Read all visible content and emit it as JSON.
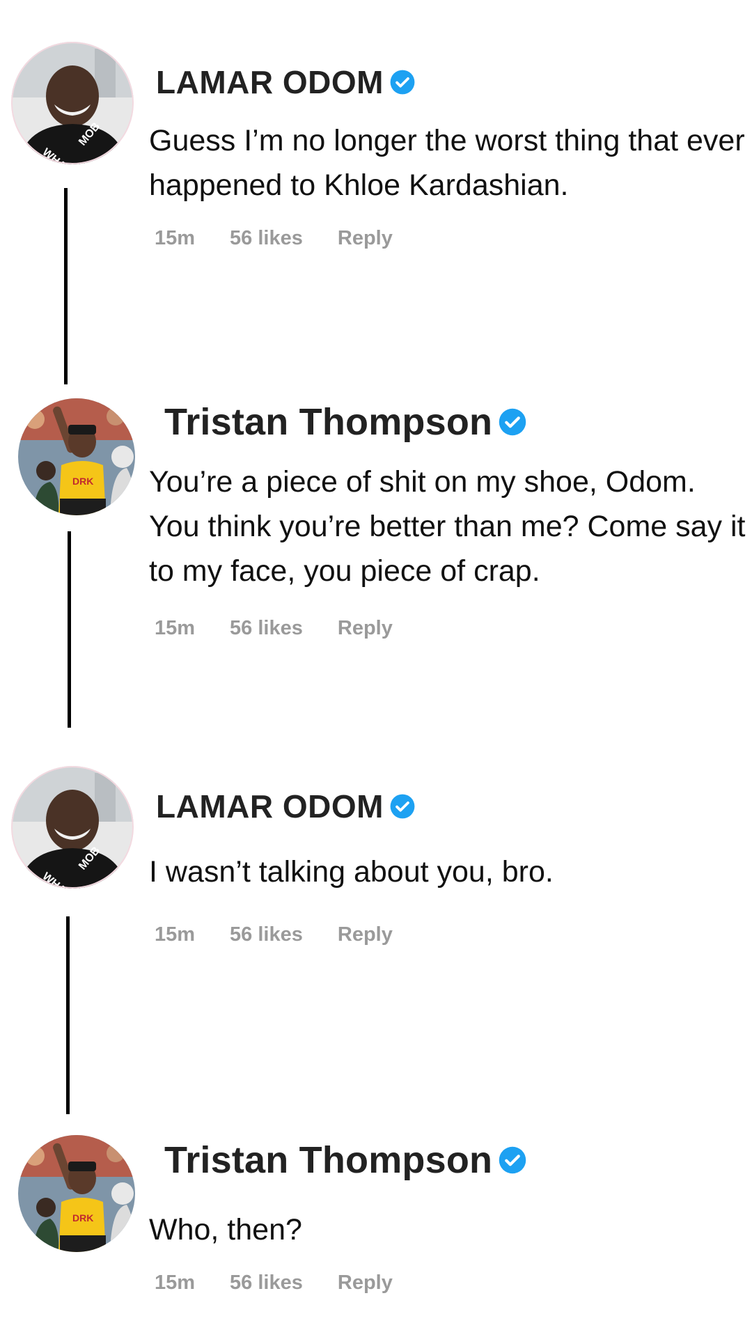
{
  "comments": [
    {
      "username": "LAMAR ODOM",
      "avatar_icon": "profile-photo-lamar",
      "verified_icon": "verified-badge-icon",
      "text": "Guess I’m no longer the worst thing that ever happened to Khloe Kardashian.",
      "time": "15m",
      "likes": "56 likes",
      "reply_label": "Reply"
    },
    {
      "username": "Tristan Thompson",
      "avatar_icon": "profile-photo-tristan",
      "verified_icon": "verified-badge-icon",
      "text": "You’re a piece of shit on my shoe, Odom. You think you’re better than me? Come say it to my face, you piece of crap.",
      "time": "15m",
      "likes": "56 likes",
      "reply_label": "Reply"
    },
    {
      "username": "LAMAR ODOM",
      "avatar_icon": "profile-photo-lamar",
      "verified_icon": "verified-badge-icon",
      "text": "I wasn’t talking about you, bro.",
      "time": "15m",
      "likes": "56 likes",
      "reply_label": "Reply"
    },
    {
      "username": "Tristan Thompson",
      "avatar_icon": "profile-photo-tristan",
      "verified_icon": "verified-badge-icon",
      "text": "Who, then?",
      "time": "15m",
      "likes": "56 likes",
      "reply_label": "Reply"
    }
  ],
  "colors": {
    "verified_blue": "#1da1f2",
    "meta_gray": "#9a9a9a",
    "thread_line": "#000000"
  }
}
